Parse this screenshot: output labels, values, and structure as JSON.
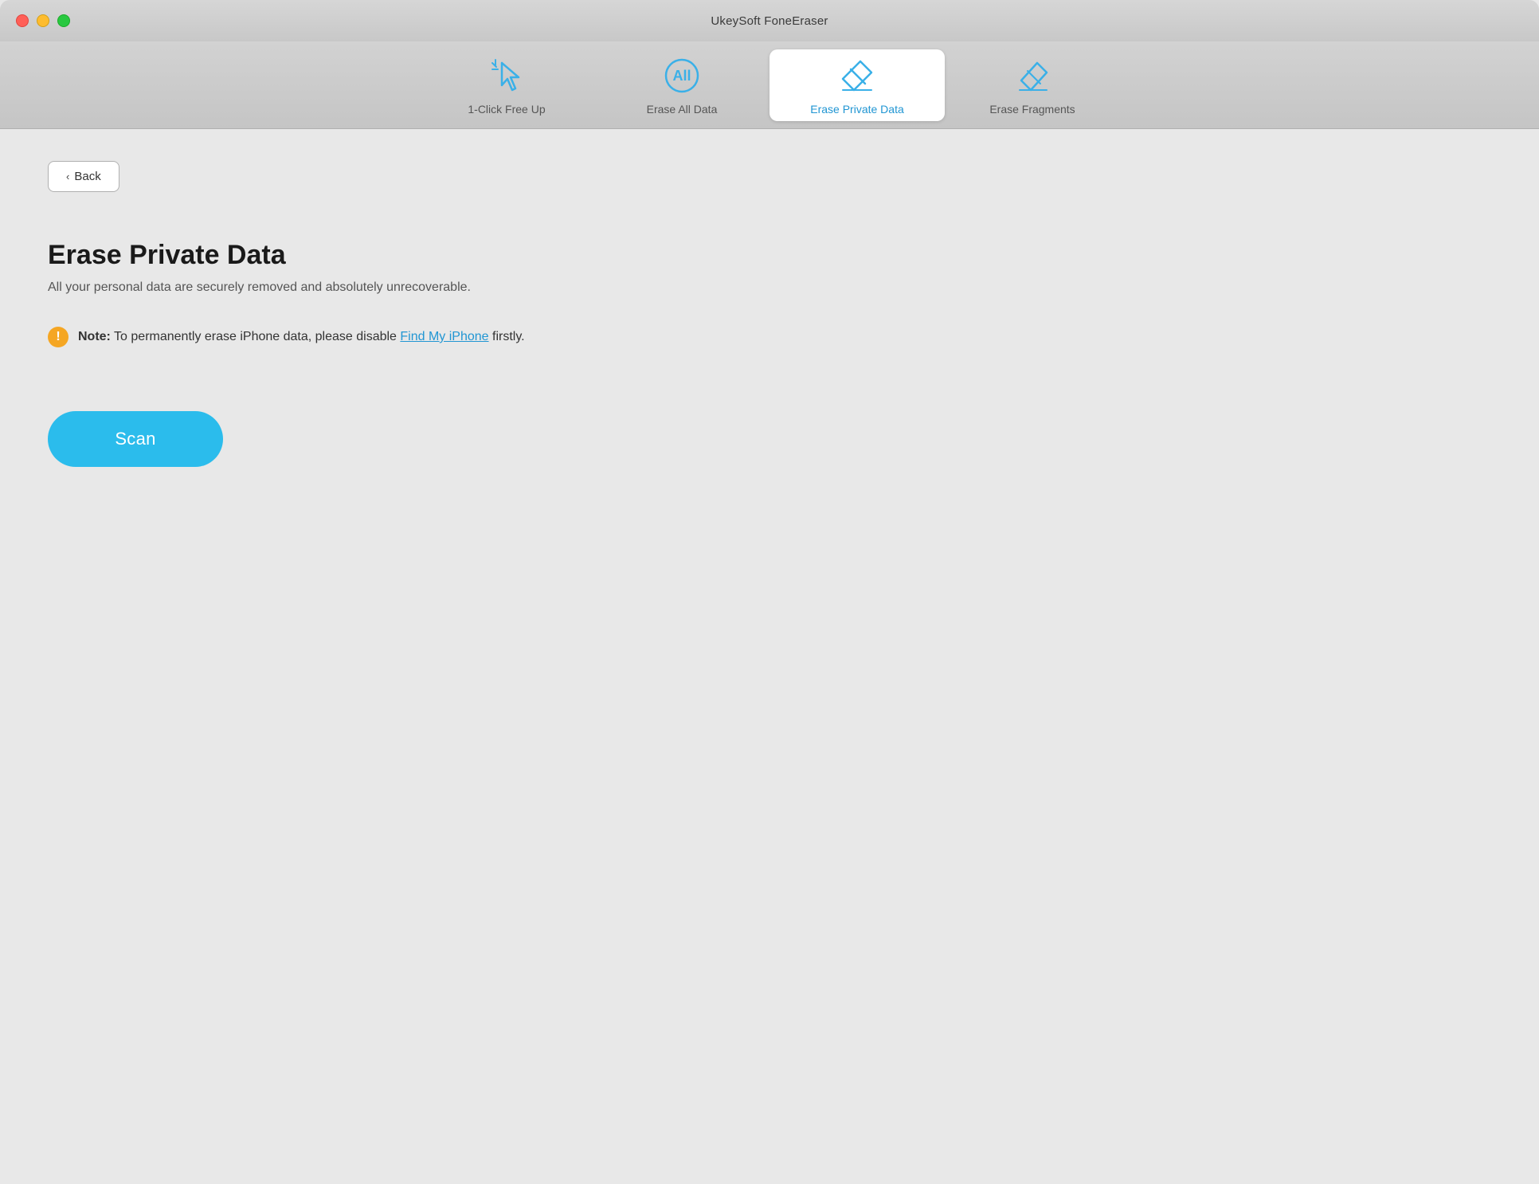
{
  "window": {
    "title": "UkeySoft FoneEraser"
  },
  "traffic_lights": {
    "close_label": "close",
    "minimize_label": "minimize",
    "maximize_label": "maximize"
  },
  "tabs": [
    {
      "id": "one-click-free-up",
      "label": "1-Click Free Up",
      "active": false
    },
    {
      "id": "erase-all-data",
      "label": "Erase All Data",
      "active": false
    },
    {
      "id": "erase-private-data",
      "label": "Erase Private Data",
      "active": true
    },
    {
      "id": "erase-fragments",
      "label": "Erase Fragments",
      "active": false
    }
  ],
  "back_button": {
    "label": "Back",
    "chevron": "‹"
  },
  "content": {
    "title": "Erase Private Data",
    "subtitle": "All your personal data are securely removed and absolutely unrecoverable.",
    "note_prefix": "Note:",
    "note_body": " To permanently erase iPhone data, please disable ",
    "note_link": "Find My iPhone",
    "note_suffix": " firstly.",
    "scan_button_label": "Scan"
  },
  "colors": {
    "blue_accent": "#2bbcec",
    "warning_orange": "#f5a623",
    "link_blue": "#2196d3",
    "tab_active_bg": "#ffffff",
    "tab_bar_bg": "#d2d2d2"
  }
}
